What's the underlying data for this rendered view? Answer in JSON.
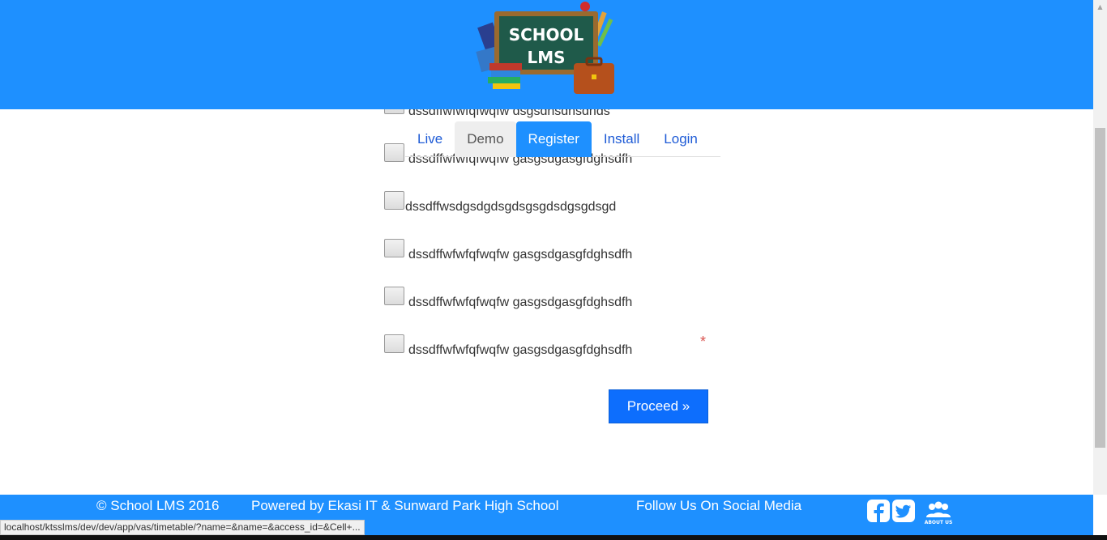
{
  "header": {
    "logo_line1": "SCHOOL",
    "logo_line2": "LMS",
    "bg_color": "#1e90ff"
  },
  "nav": {
    "tabs": [
      {
        "label": "Live",
        "state": "normal"
      },
      {
        "label": "Demo",
        "state": "hover"
      },
      {
        "label": "Register",
        "state": "active"
      },
      {
        "label": "Install",
        "state": "normal"
      },
      {
        "label": "Login",
        "state": "normal"
      }
    ]
  },
  "options": [
    {
      "label": "dssdffwfwfqfwqfw dsgsdhsdhsdhds"
    },
    {
      "label": "dssdffwfwfqfwqfw gasgsdgasgfdghsdfh"
    },
    {
      "label": "dssdffwsdgsdgdsgdsgsgdsdgsgdsgd"
    },
    {
      "label": "dssdffwfwfqfwqfw gasgsdgasgfdghsdfh"
    },
    {
      "label": "dssdffwfwfqfwqfw gasgsdgasgfdghsdfh"
    },
    {
      "label": "dssdffwfwfqfwqfw gasgsdgasgfdghsdfh"
    }
  ],
  "required_mark": "*",
  "proceed_label": "Proceed »",
  "footer": {
    "copyright": "© School LMS 2016",
    "powered_by": "Powered by Ekasi IT & Sunward Park High School",
    "follow": "Follow Us On Social Media",
    "about_label": "ABOUT US",
    "icons": [
      "facebook-icon",
      "twitter-icon",
      "about-us-icon"
    ]
  },
  "status_bar": {
    "url": "localhost/ktsslms/dev/dev/app/vas/timetable/?name=&name=&access_id=&Cell+..."
  },
  "colors": {
    "primary": "#1e90ff",
    "button": "#0d6efd",
    "required": "#d9534f"
  }
}
